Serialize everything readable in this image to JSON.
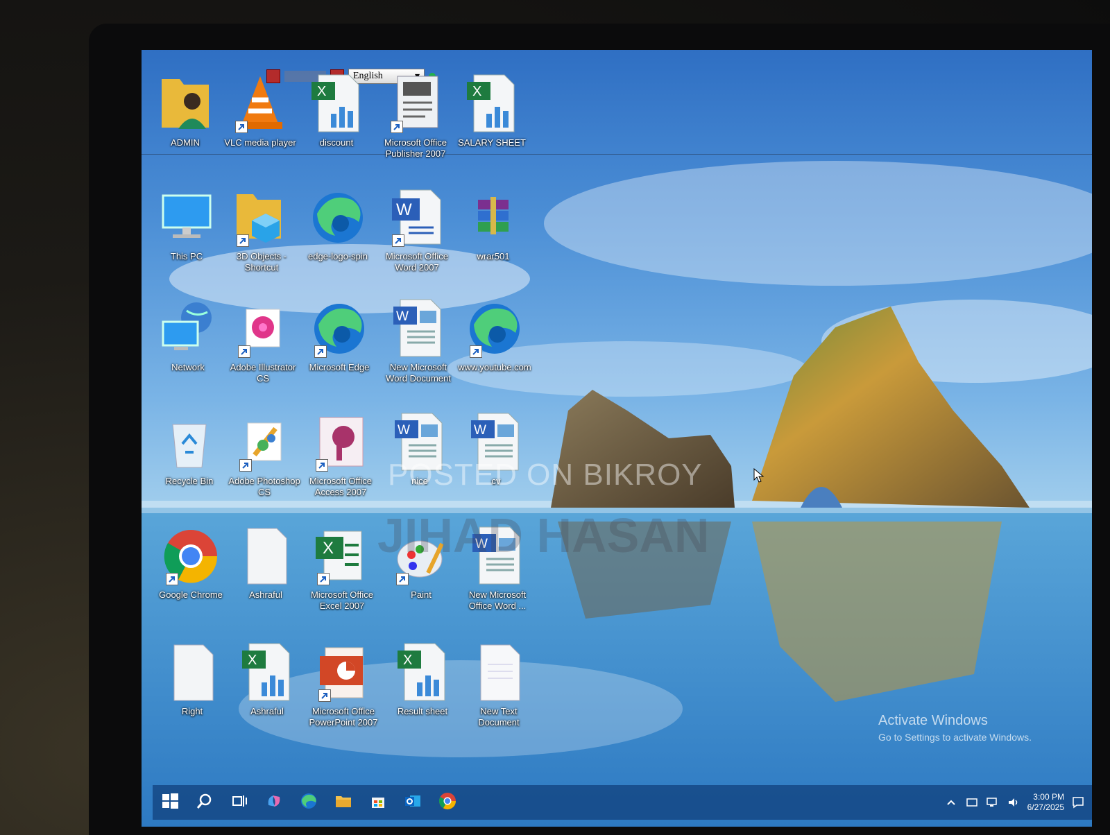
{
  "language_bar": {
    "language": "English"
  },
  "icons": [
    {
      "label": "ADMIN",
      "kind": "user-folder-icon"
    },
    {
      "label": "VLC media player",
      "kind": "vlc-icon",
      "shortcut": true
    },
    {
      "label": "discount",
      "kind": "excel-file-icon"
    },
    {
      "label": "Microsoft Office Publisher 2007",
      "kind": "publisher-icon",
      "shortcut": true
    },
    {
      "label": "SALARY SHEET",
      "kind": "excel-file-icon"
    },
    {
      "label": "This PC",
      "kind": "this-pc-icon"
    },
    {
      "label": "3D Objects - Shortcut",
      "kind": "folder-3d-icon",
      "shortcut": true
    },
    {
      "label": "edge-logo-spin",
      "kind": "edge-icon"
    },
    {
      "label": "Microsoft Office Word 2007",
      "kind": "word-app-icon",
      "shortcut": true
    },
    {
      "label": "wrar501",
      "kind": "winrar-icon"
    },
    {
      "label": "Network",
      "kind": "network-icon"
    },
    {
      "label": "Adobe Illustrator CS",
      "kind": "illustrator-icon",
      "shortcut": true
    },
    {
      "label": "Microsoft Edge",
      "kind": "edge-icon",
      "shortcut": true
    },
    {
      "label": "New Microsoft Word Document",
      "kind": "word-file-icon"
    },
    {
      "label": "www.youtube.com",
      "kind": "edge-icon",
      "shortcut": true
    },
    {
      "label": "Recycle Bin",
      "kind": "recycle-bin-icon"
    },
    {
      "label": "Adobe Photoshop CS",
      "kind": "photoshop-icon",
      "shortcut": true
    },
    {
      "label": "Microsoft Office Access 2007",
      "kind": "access-icon",
      "shortcut": true
    },
    {
      "label": "nice",
      "kind": "word-file-icon"
    },
    {
      "label": "cv",
      "kind": "word-file-icon"
    },
    {
      "label": "Google Chrome",
      "kind": "chrome-icon",
      "shortcut": true
    },
    {
      "label": "Ashraful",
      "kind": "blank-file-icon"
    },
    {
      "label": "Microsoft Office Excel 2007",
      "kind": "excel-app-icon",
      "shortcut": true
    },
    {
      "label": "Paint",
      "kind": "paint-icon",
      "shortcut": true
    },
    {
      "label": "New Microsoft Office Word ...",
      "kind": "word-file-icon"
    },
    {
      "label": "Right",
      "kind": "blank-file-icon"
    },
    {
      "label": "Ashraful",
      "kind": "excel-file-icon"
    },
    {
      "label": "Microsoft Office PowerPoint 2007",
      "kind": "powerpoint-icon",
      "shortcut": true
    },
    {
      "label": "Result sheet",
      "kind": "excel-file-icon"
    },
    {
      "label": "New Text Document",
      "kind": "text-file-icon"
    }
  ],
  "watermark": {
    "posted": "POSTED ON BIKROY",
    "name": "JIHAD HASAN"
  },
  "activation": {
    "title": "Activate Windows",
    "subtitle": "Go to Settings to activate Windows."
  },
  "taskbar": {
    "buttons": [
      "windows-start-icon",
      "search-icon",
      "task-view-icon",
      "copilot-icon",
      "edge-icon",
      "file-explorer-icon",
      "store-icon",
      "outlook-icon",
      "chrome-icon"
    ],
    "clock": {
      "time": "3:00 PM",
      "date": "6/27/2025"
    }
  },
  "colors": {
    "taskbar": "#14468a",
    "accent": "#0078d7"
  }
}
